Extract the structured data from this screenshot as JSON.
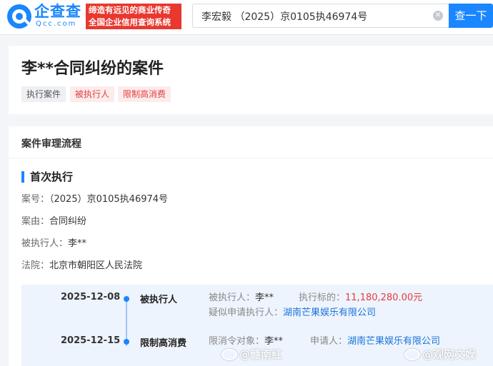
{
  "header": {
    "logo_text": "企查查",
    "logo_sub": "Qcc.com",
    "slogan_line1": "缔造有远见的商业传奇",
    "slogan_line2": "全国企业信用查询系统",
    "search_value": "李宏毅 （2025）京0105执46974号",
    "search_button": "查一下"
  },
  "case": {
    "title": "李**合同纠纷的案件",
    "tags": [
      "执行案件",
      "被执行人",
      "限制高消费"
    ]
  },
  "process": {
    "section_title": "案件审理流程",
    "stage_title": "首次执行",
    "fields": [
      {
        "label": "案号：",
        "value": "（2025）京0105执46974号"
      },
      {
        "label": "案由：",
        "value": "合同纠纷"
      },
      {
        "label": "被执行人：",
        "value": "李**"
      },
      {
        "label": "法院：",
        "value": "北京市朝阳区人民法院"
      }
    ],
    "timeline": [
      {
        "date": "2025-12-08",
        "type": "被执行人",
        "f1_label": "被执行人：",
        "f1_value": "李**",
        "f2_label": "执行标的：",
        "f2_value": "11,180,280.00元",
        "f3_label": "疑似申请执行人：",
        "f3_value": "湖南芒果娱乐有限公司"
      },
      {
        "date": "2025-12-15",
        "type": "限制高消费",
        "f1_label": "限消令对象：",
        "f1_value": "李**",
        "f2_label": "申请人：",
        "f2_value": "湖南芒果娱乐有限公司"
      }
    ]
  },
  "watermarks": [
    "@赣南红",
    "@观网文娱"
  ],
  "colors": {
    "accent": "#1a86ff",
    "danger": "#e33d3d",
    "link": "#1a73d9"
  }
}
